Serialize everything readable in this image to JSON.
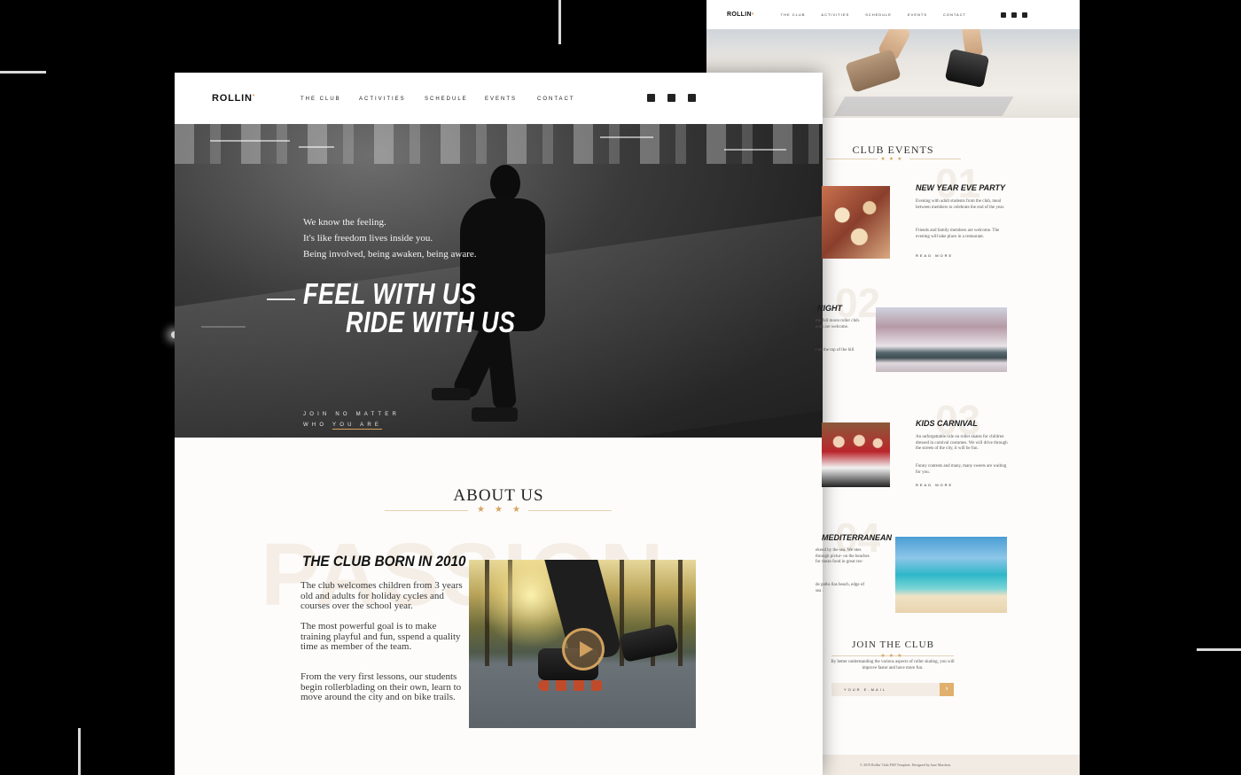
{
  "back_page": {
    "nav": {
      "logo": "ROLLIN",
      "menu": [
        "THE CLUB",
        "ACTIVITIES",
        "SCHEDULE",
        "EVENTS",
        "CONTACT"
      ],
      "social_icons": [
        "facebook-icon",
        "twitter-icon",
        "instagram-icon"
      ]
    },
    "events_title": "CLUB EVENTS",
    "stars": "★★★",
    "events": [
      {
        "number": "01",
        "title": "NEW YEAR EVE PARTY",
        "text1": "Evening with adult students from the club, meal between members to celebrate the end of the year.",
        "text2": "Friends and family members are welcome. The evening will take place in a restaurant.",
        "more": "READ MORE"
      },
      {
        "number": "02",
        "title": "NIGHT",
        "text1": "the full moon roller club. ends are welcome.",
        "text2": "t on the top of the hill"
      },
      {
        "number": "03",
        "title": "KIDS CARNIVAL",
        "text1": "An unforgettable ride on roller skates for children dressed in carnival costumes. We will drive through the streets of the city, it will be fun.",
        "text2": "Funny contests and many, many sweets are waiting for you.",
        "more": "READ MORE"
      },
      {
        "number": "04",
        "title": "MEDITERRANEAN",
        "text1": "ekend by the sea. We ntes through pictur- on the beaches for mean food in great res-",
        "text2": "de paths llas beach, edge of sea ."
      }
    ],
    "join": {
      "title": "JOIN THE CLUB",
      "text": "By better understanding the various aspects of roller skating, you will improve faster and have more fun.",
      "email_placeholder": "YOUR E-MAIL",
      "submit": "›"
    },
    "footer": "© 2019 Rollin' Club PSD Template. Designed by Jane Marchen."
  },
  "front_page": {
    "nav": {
      "logo": "ROLLIN",
      "logo_mark": "•",
      "menu": [
        "THE CLUB",
        "ACTIVITIES",
        "SCHEDULE",
        "EVENTS",
        "CONTACT"
      ],
      "social_icons": [
        "facebook-icon",
        "twitter-icon",
        "instagram-icon"
      ]
    },
    "hero": {
      "quote": [
        "We know the feeling.",
        "It's like freedom lives inside you.",
        "Being involved, being awaken, being aware."
      ],
      "title_line1": "FEEL WITH US",
      "title_line2": "RIDE WITH US",
      "cta_line1": "JOIN NO MATTER",
      "cta_line2_a": "WHO",
      "cta_line2_b": "YOU ARE"
    },
    "about": {
      "title": "ABOUT US",
      "stars": "★★★",
      "background_word": "PASSION",
      "club_title": "THE CLUB BORN IN 2010",
      "paragraphs": [
        "The club welcomes children from 3 years old and adults for holiday cycles and courses over the school year.",
        "The most powerful goal is to make training playful and fun, sspend a quality time as member of the team.",
        "From the very first lessons, our students begin rollerblading on their own, learn to move around the city and on bike trails."
      ]
    }
  },
  "colors": {
    "accent": "#d6a460",
    "background": "#000000",
    "page": "#fdfcfb"
  }
}
